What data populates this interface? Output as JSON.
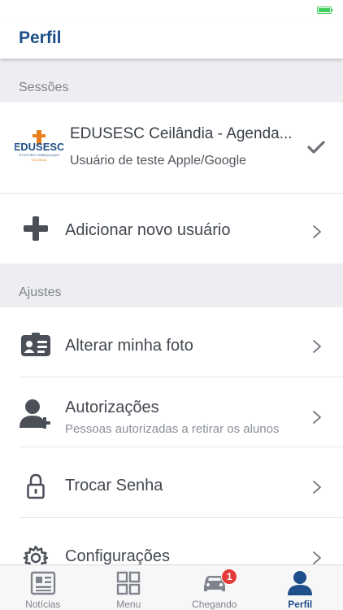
{
  "header": {
    "title": "Perfil"
  },
  "sections": {
    "sessions": "Sessões",
    "settings": "Ajustes"
  },
  "session": {
    "logo_text": "EDUSESC",
    "logo_tagline": "O FUTURO COMEÇA AQUI",
    "logo_city": "CEILÂNDIA",
    "title": "EDUSESC Ceilândia - Agenda...",
    "subtitle": "Usuário de teste Apple/Google"
  },
  "add_user": {
    "label": "Adicionar novo usuário"
  },
  "settings_items": [
    {
      "label": "Alterar minha foto",
      "icon": "id-card-icon"
    },
    {
      "label": "Autorizações",
      "subtitle": "Pessoas autorizadas a retirar os alunos",
      "icon": "add-person-icon"
    },
    {
      "label": "Trocar Senha",
      "icon": "lock-icon"
    },
    {
      "label": "Configurações",
      "icon": "gear-icon"
    }
  ],
  "tabs": [
    {
      "label": "Notícias",
      "icon": "newspaper-icon"
    },
    {
      "label": "Menu",
      "icon": "grid-icon"
    },
    {
      "label": "Chegando",
      "icon": "car-icon",
      "badge": "1"
    },
    {
      "label": "Perfil",
      "icon": "person-icon",
      "active": true
    }
  ],
  "colors": {
    "brand_blue": "#1f4f8a",
    "background": "#eeeef2",
    "badge_red": "#e43a3a",
    "battery_green": "#3ecf5c"
  }
}
